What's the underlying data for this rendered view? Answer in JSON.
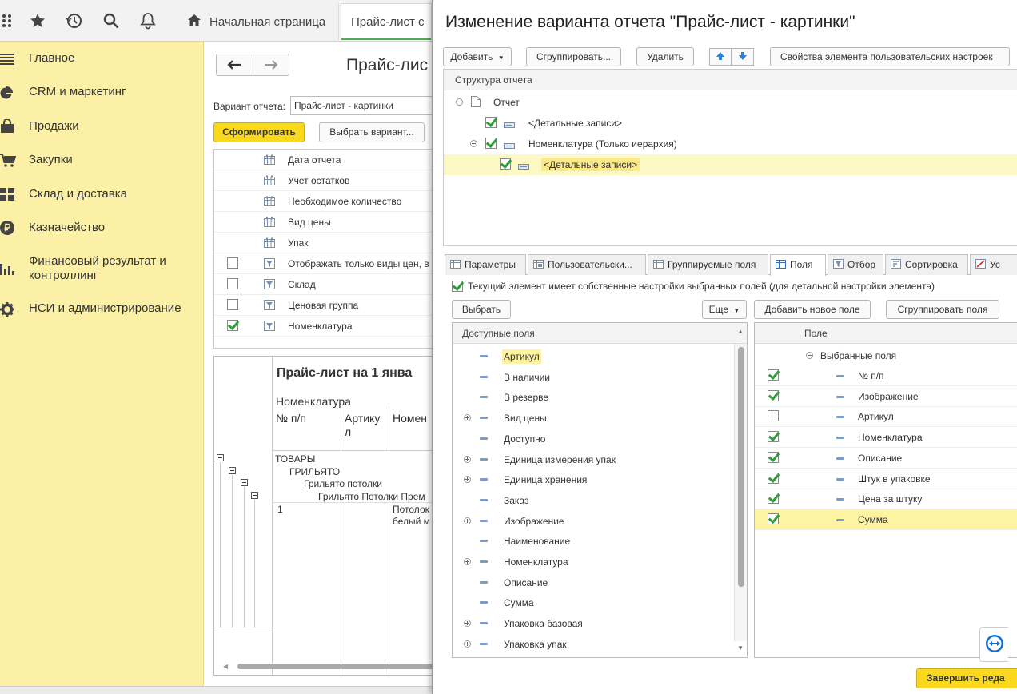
{
  "topbar": {
    "icons": [
      "apps-grid-icon",
      "star-icon",
      "history-icon",
      "search-icon",
      "bell-icon"
    ],
    "home_tab": "Начальная страница",
    "price_tab": "Прайс-лист с"
  },
  "sidebar": {
    "items": [
      {
        "label": "Главное",
        "icon": "menu-icon"
      },
      {
        "label": "CRM и маркетинг",
        "icon": "pie-icon"
      },
      {
        "label": "Продажи",
        "icon": "bag-icon"
      },
      {
        "label": "Закупки",
        "icon": "cart-icon"
      },
      {
        "label": "Склад и доставка",
        "icon": "grid-icon"
      },
      {
        "label": "Казначейство",
        "icon": "ruble-icon"
      },
      {
        "label": "Финансовый результат и контроллинг",
        "icon": "bar-chart-icon"
      },
      {
        "label": "НСИ и администрирование",
        "icon": "gear-icon"
      }
    ]
  },
  "report": {
    "title": "Прайс-лис",
    "variant_label": "Вариант отчета:",
    "variant_value": "Прайс-лист - картинки",
    "generate_button": "Сформировать",
    "choose_variant_button": "Выбрать вариант...",
    "settings": [
      {
        "label": "Дата отчета",
        "checkbox": false,
        "checked": false
      },
      {
        "label": "Учет остатков",
        "checkbox": false,
        "checked": false
      },
      {
        "label": "Необходимое количество",
        "checkbox": false,
        "checked": false
      },
      {
        "label": "Вид цены",
        "checkbox": false,
        "checked": false
      },
      {
        "label": "Упак",
        "checkbox": false,
        "checked": false
      },
      {
        "label": "Отображать только виды цен, в",
        "checkbox": true,
        "checked": false
      },
      {
        "label": "Склад",
        "checkbox": true,
        "checked": false
      },
      {
        "label": "Ценовая группа",
        "checkbox": true,
        "checked": false
      },
      {
        "label": "Номенклатура",
        "checkbox": true,
        "checked": true
      }
    ],
    "preview": {
      "title": "Прайс-лист на 1 янва",
      "group_header": "Номенклатура",
      "col_num": "№ п/п",
      "col_art": "Артику л",
      "col_name": "Номен",
      "rows": [
        "ТОВАРЫ",
        "ГРИЛЬЯТО",
        "Грильято потолки",
        "Грильято Потолки Прем"
      ],
      "item_num": "1",
      "item_name": "Потолок белый м"
    }
  },
  "dialog": {
    "title": "Изменение варианта отчета \"Прайс-лист - картинки\"",
    "toolbar": {
      "add": "Добавить",
      "group": "Сгруппировать...",
      "delete": "Удалить",
      "properties": "Свойства элемента пользовательских настроек"
    },
    "structure": {
      "header": "Структура отчета",
      "nodes": [
        {
          "label": "Отчет"
        },
        {
          "label": "<Детальные записи>"
        },
        {
          "label": "Номенклатура (Только иерархия)"
        },
        {
          "label": "<Детальные записи>"
        }
      ]
    },
    "tabs": [
      "Параметры",
      "Пользовательски...",
      "Группируемые поля",
      "Поля",
      "Отбор",
      "Сортировка",
      "Ус"
    ],
    "own_settings_label": "Текущий элемент имеет собственные настройки выбранных полей (для детальной настройки элемента)",
    "buttons": {
      "select": "Выбрать",
      "more": "Еще",
      "add_new_field": "Добавить новое поле",
      "group_fields": "Сгруппировать поля"
    },
    "available": {
      "header": "Доступные поля",
      "fields": [
        {
          "label": "Артикул",
          "expandable": false
        },
        {
          "label": "В наличии",
          "expandable": false
        },
        {
          "label": "В резерве",
          "expandable": false
        },
        {
          "label": "Вид цены",
          "expandable": true
        },
        {
          "label": "Доступно",
          "expandable": false
        },
        {
          "label": "Единица измерения упак",
          "expandable": true
        },
        {
          "label": "Единица хранения",
          "expandable": true
        },
        {
          "label": "Заказ",
          "expandable": false
        },
        {
          "label": "Изображение",
          "expandable": true
        },
        {
          "label": "Наименование",
          "expandable": false
        },
        {
          "label": "Номенклатура",
          "expandable": true
        },
        {
          "label": "Описание",
          "expandable": false
        },
        {
          "label": "Сумма",
          "expandable": false
        },
        {
          "label": "Упаковка базовая",
          "expandable": true
        },
        {
          "label": "Упаковка упак",
          "expandable": true
        }
      ]
    },
    "selected": {
      "header": "Поле",
      "group": "Выбранные поля",
      "fields": [
        {
          "label": "№ п/п",
          "checked": true
        },
        {
          "label": "Изображение",
          "checked": true
        },
        {
          "label": "Артикул",
          "checked": false
        },
        {
          "label": "Номенклатура",
          "checked": true
        },
        {
          "label": "Описание",
          "checked": true
        },
        {
          "label": "Штук в упаковке",
          "checked": true
        },
        {
          "label": "Цена за штуку",
          "checked": true
        },
        {
          "label": "Сумма",
          "checked": true
        }
      ]
    },
    "finish_button": "Завершить реда"
  },
  "colors": {
    "sidebar_bg": "#fbf0a5",
    "accent_yellow": "#f9d81e",
    "selection": "#fdf3a0",
    "check_green": "#2e9d3a"
  }
}
